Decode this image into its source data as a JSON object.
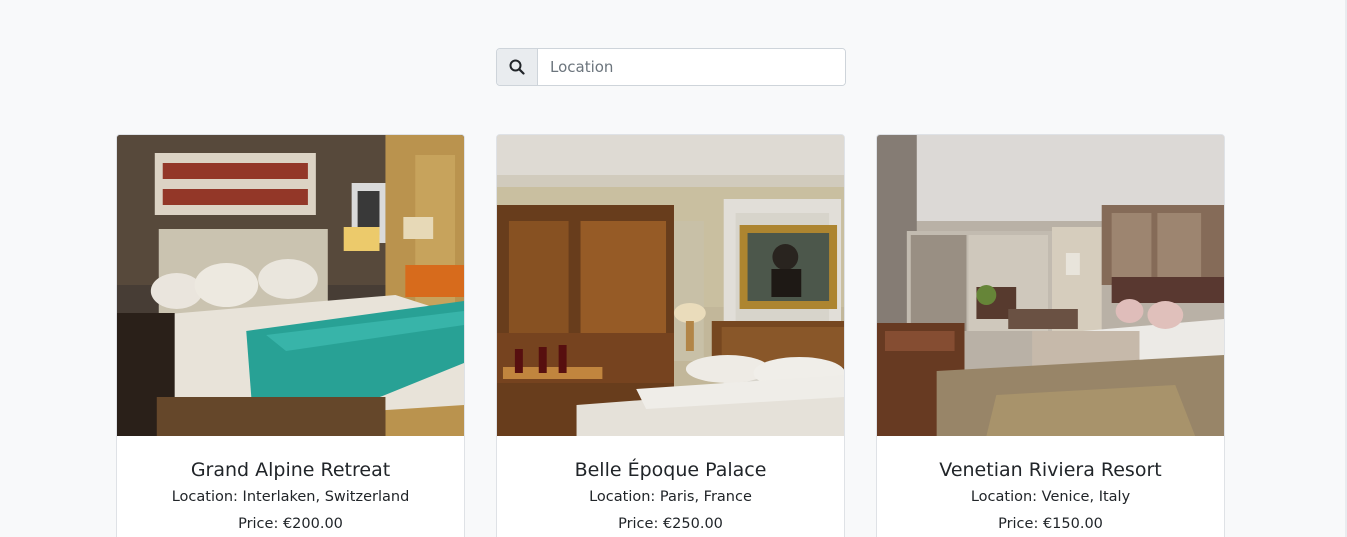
{
  "search": {
    "placeholder": "Location",
    "icon": "search-icon"
  },
  "hotels": [
    {
      "name": "Grand Alpine Retreat",
      "location": "Location: Interlaken, Switzerland",
      "price": "Price: €200.00"
    },
    {
      "name": "Belle Époque Palace",
      "location": "Location: Paris, France",
      "price": "Price: €250.00"
    },
    {
      "name": "Venetian Riviera Resort",
      "location": "Location: Venice, Italy",
      "price": "Price: €150.00"
    }
  ]
}
